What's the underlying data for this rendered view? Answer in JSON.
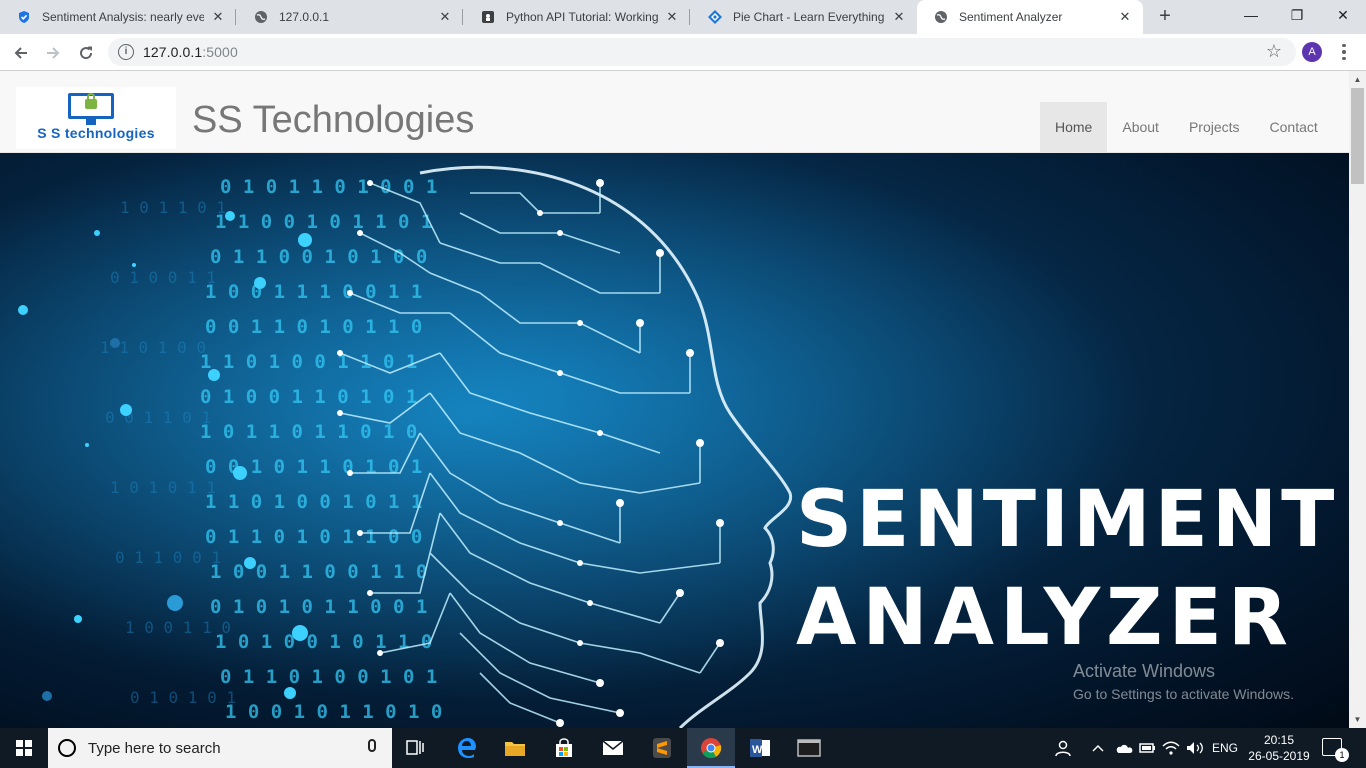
{
  "browser": {
    "tabs": [
      {
        "title": "Sentiment Analysis: nearly eve",
        "favicon": "shield-check-icon"
      },
      {
        "title": "127.0.0.1",
        "favicon": "globe-icon"
      },
      {
        "title": "Python API Tutorial: Working w",
        "favicon": "dark-square-icon"
      },
      {
        "title": "Pie Chart - Learn Everything Ab",
        "favicon": "tableau-diamond-icon"
      },
      {
        "title": "Sentiment Analyzer",
        "favicon": "globe-icon"
      }
    ],
    "active_tab_index": 4,
    "close_glyph": "✕",
    "new_tab_glyph": "+",
    "window_controls": {
      "minimize": "—",
      "maximize": "❐",
      "close": "✕"
    },
    "url_host": "127.0.0.1",
    "url_port": ":5000",
    "profile_initial": "A"
  },
  "site": {
    "logo_text": "S S technologies",
    "brand": "SS Technologies",
    "nav": [
      {
        "label": "Home",
        "active": true
      },
      {
        "label": "About",
        "active": false
      },
      {
        "label": "Projects",
        "active": false
      },
      {
        "label": "Contact",
        "active": false
      }
    ],
    "hero": {
      "line1": "SENTIMENT",
      "line2": "ANALYZER",
      "carousel_slides": 2,
      "carousel_active": 0
    }
  },
  "watermark": {
    "title": "Activate Windows",
    "subtitle": "Go to Settings to activate Windows."
  },
  "taskbar": {
    "search_placeholder": "Type here to search",
    "lang": "ENG",
    "time": "20:15",
    "date": "26-05-2019",
    "notification_count": "1"
  },
  "colors": {
    "accent_tab_strip": "#dee1e6",
    "hero_dark": "#021428",
    "hero_glow": "#31c6f0",
    "taskbar": "#0f1a25",
    "avatar": "#5e35b1"
  }
}
